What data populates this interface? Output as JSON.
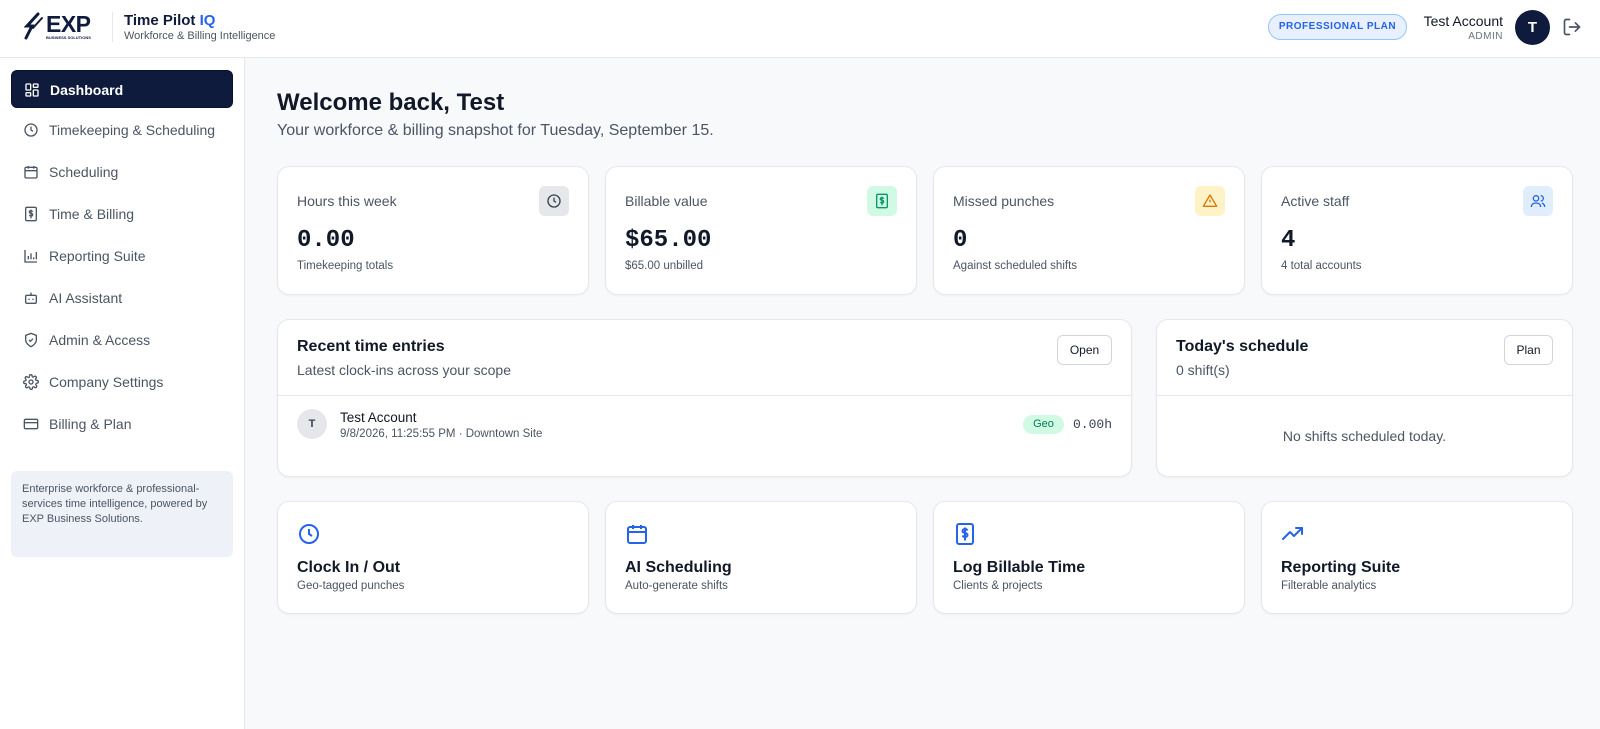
{
  "header": {
    "logo_text": "EXP",
    "logo_subtext": "BUSINESS SOLUTIONS",
    "product_name": "Time Pilot",
    "product_suffix": "IQ",
    "product_tagline": "Workforce & Billing Intelligence",
    "plan_badge": "PROFESSIONAL PLAN",
    "user_name": "Test Account",
    "user_role": "ADMIN",
    "avatar_initial": "T"
  },
  "sidebar": {
    "items": [
      {
        "label": "Dashboard",
        "icon": "grid-icon",
        "active": true
      },
      {
        "label": "Timekeeping & Scheduling",
        "icon": "clock-icon"
      },
      {
        "label": "Scheduling",
        "icon": "calendar-icon"
      },
      {
        "label": "Time & Billing",
        "icon": "dollar-receipt-icon"
      },
      {
        "label": "Reporting Suite",
        "icon": "bar-chart-icon"
      },
      {
        "label": "AI Assistant",
        "icon": "bot-icon"
      },
      {
        "label": "Admin & Access",
        "icon": "shield-icon"
      },
      {
        "label": "Company Settings",
        "icon": "gear-icon"
      },
      {
        "label": "Billing & Plan",
        "icon": "credit-card-icon"
      }
    ],
    "note": "Enterprise workforce & professional-services time intelligence, powered by EXP Business Solutions."
  },
  "main": {
    "welcome": "Welcome back, Test",
    "snapshot": "Your workforce & billing snapshot for Tuesday, September 15.",
    "stats": [
      {
        "label": "Hours this week",
        "value": "0.00",
        "sub": "Timekeeping totals",
        "icon": "clock-icon",
        "icon_bg": "#e5e7eb",
        "icon_color": "#374151"
      },
      {
        "label": "Billable value",
        "value": "$65.00",
        "sub": "$65.00 unbilled",
        "icon": "dollar-receipt-icon",
        "icon_bg": "#d1fae5",
        "icon_color": "#059669"
      },
      {
        "label": "Missed punches",
        "value": "0",
        "sub": "Against scheduled shifts",
        "icon": "warning-icon",
        "icon_bg": "#fef3c7",
        "icon_color": "#d97706"
      },
      {
        "label": "Active staff",
        "value": "4",
        "sub": "4 total accounts",
        "icon": "users-icon",
        "icon_bg": "#e0edfb",
        "icon_color": "#2563eb"
      }
    ],
    "recent_entries": {
      "title": "Recent time entries",
      "subtitle": "Latest clock-ins across your scope",
      "button": "Open",
      "entries": [
        {
          "initial": "T",
          "name": "Test Account",
          "meta": "9/8/2026, 11:25:55 PM · Downtown Site",
          "badge": "Geo",
          "hours": "0.00h"
        }
      ]
    },
    "schedule": {
      "title": "Today's schedule",
      "subtitle": "0 shift(s)",
      "button": "Plan",
      "empty": "No shifts scheduled today."
    },
    "actions": [
      {
        "title": "Clock In / Out",
        "sub": "Geo-tagged punches",
        "icon": "clock-icon"
      },
      {
        "title": "AI Scheduling",
        "sub": "Auto-generate shifts",
        "icon": "calendar-icon"
      },
      {
        "title": "Log Billable Time",
        "sub": "Clients & projects",
        "icon": "dollar-receipt-icon"
      },
      {
        "title": "Reporting Suite",
        "sub": "Filterable analytics",
        "icon": "trending-up-icon"
      }
    ],
    "accent_color": "#2563eb",
    "navy_color": "#0f1b3d"
  }
}
